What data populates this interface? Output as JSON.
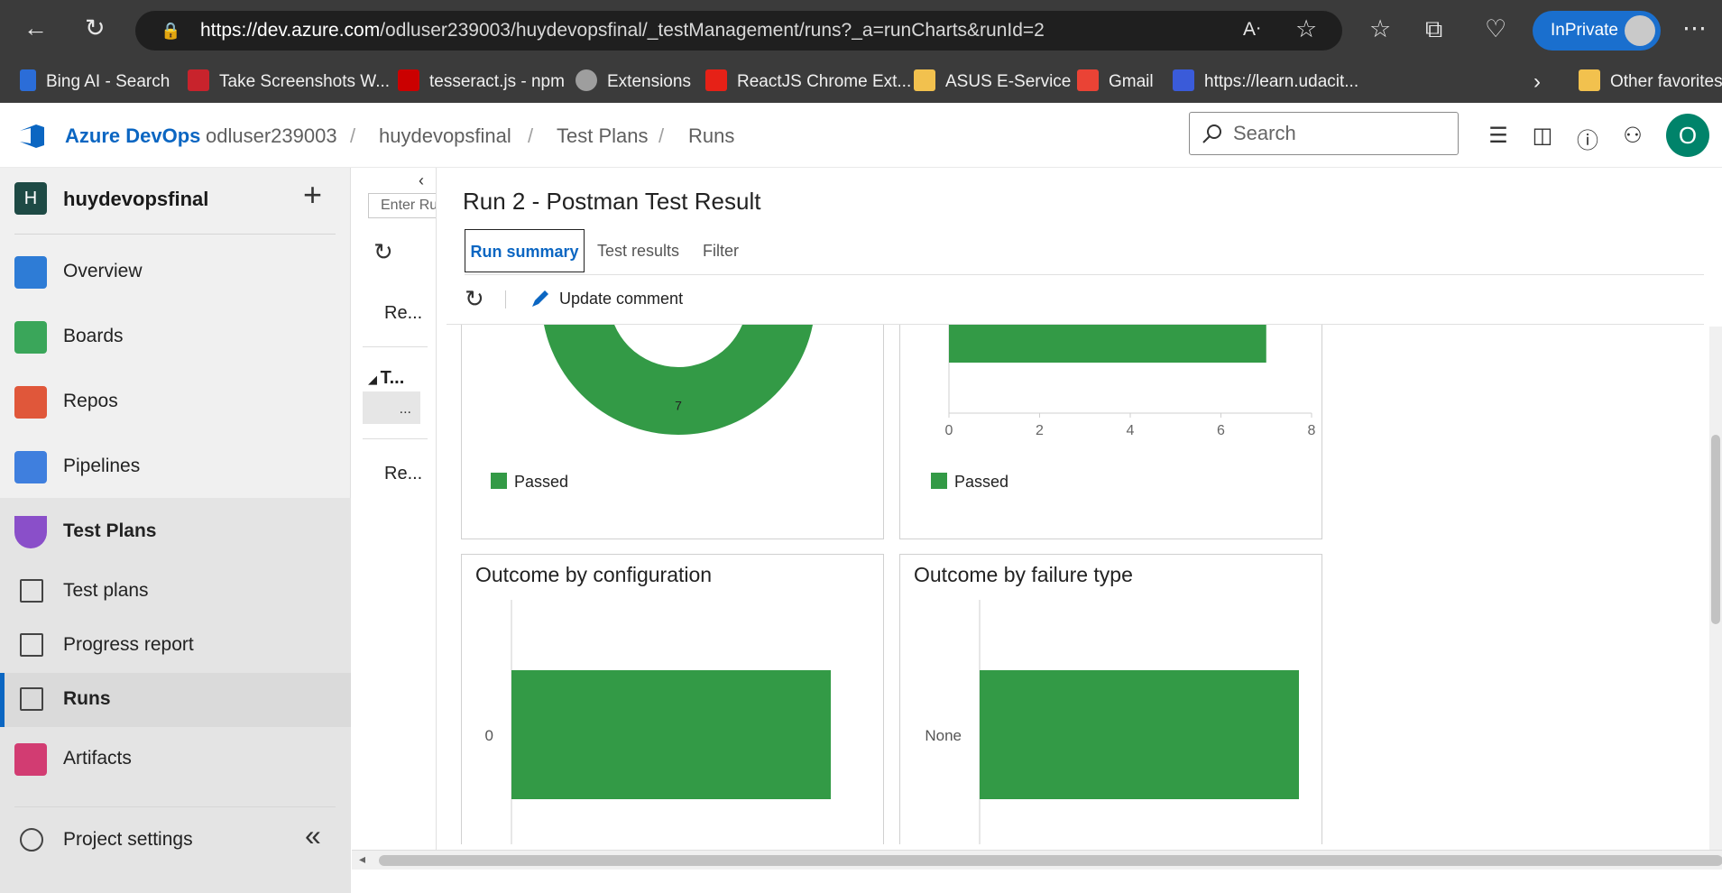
{
  "browser": {
    "url_host": "https://dev.azure.com",
    "url_path": "/odluser239003/huydevopsfinal/_testManagement/runs?_a=runCharts&runId=2",
    "inprivate_label": "InPrivate",
    "favorites": [
      {
        "label": "Bing AI - Search",
        "color": "#2b6dd8"
      },
      {
        "label": "Take Screenshots W...",
        "color": "#c8232c"
      },
      {
        "label": "tesseract.js - npm",
        "color": "#cb0000"
      },
      {
        "label": "Extensions",
        "color": "#9e9e9e"
      },
      {
        "label": "ReactJS Chrome Ext...",
        "color": "#e62117"
      },
      {
        "label": "ASUS E-Service",
        "color": "#f2c14e"
      },
      {
        "label": "Gmail",
        "color": "#ea4335"
      },
      {
        "label": "https://learn.udacit...",
        "color": "#3a5bd9"
      }
    ],
    "other_favorites": "Other favorites"
  },
  "header": {
    "brand": "Azure DevOps",
    "breadcrumb": [
      "odluser239003",
      "huydevopsfinal",
      "Test Plans",
      "Runs"
    ],
    "search_placeholder": "Search",
    "user_initial": "O"
  },
  "sidebar": {
    "project_initial": "H",
    "project_name": "huydevopsfinal",
    "items": [
      {
        "label": "Overview"
      },
      {
        "label": "Boards"
      },
      {
        "label": "Repos"
      },
      {
        "label": "Pipelines"
      },
      {
        "label": "Test Plans"
      },
      {
        "label": "Test plans"
      },
      {
        "label": "Progress report"
      },
      {
        "label": "Runs"
      },
      {
        "label": "Artifacts"
      }
    ],
    "settings_label": "Project settings"
  },
  "runs_panel": {
    "filter_placeholder": "Enter Ru",
    "item1": "Re...",
    "group": "T...",
    "selected": "...",
    "item2": "Re..."
  },
  "main": {
    "title": "Run 2 - Postman Test Result",
    "tabs": [
      "Run summary",
      "Test results",
      "Filter"
    ],
    "update_comment": "Update comment"
  },
  "colors": {
    "passed": "#339a46",
    "accent": "#0b66c2"
  },
  "chart_data": [
    {
      "type": "pie",
      "title": "",
      "categories": [
        "Passed"
      ],
      "values": [
        7
      ],
      "legend": [
        "Passed"
      ]
    },
    {
      "type": "bar",
      "title": "",
      "orientation": "horizontal",
      "series": [
        {
          "name": "Passed",
          "values": [
            7
          ]
        }
      ],
      "xlim": [
        0,
        8
      ],
      "xticks": [
        "0",
        "2",
        "4",
        "6",
        "8"
      ],
      "legend": [
        "Passed"
      ]
    },
    {
      "type": "bar",
      "title": "Outcome by configuration",
      "orientation": "horizontal",
      "categories": [
        "0"
      ],
      "values": [
        7
      ]
    },
    {
      "type": "bar",
      "title": "Outcome by failure type",
      "orientation": "horizontal",
      "categories": [
        "None"
      ],
      "values": [
        7
      ]
    }
  ]
}
